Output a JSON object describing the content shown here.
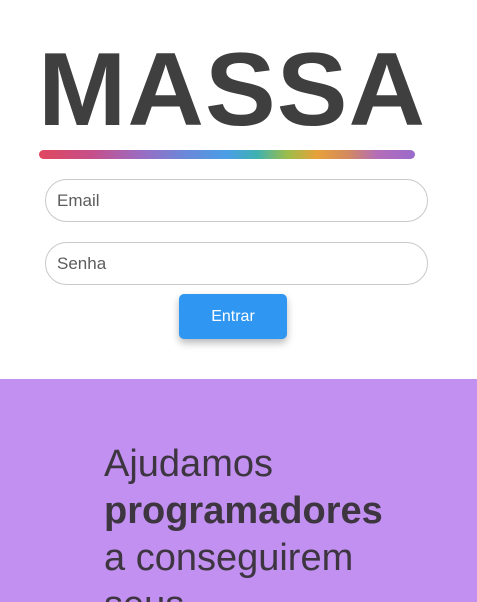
{
  "logo": {
    "text": "MASSA",
    "gradient_colors": [
      "#e0475e",
      "#c64f8a",
      "#9b6cc2",
      "#6e86d8",
      "#4a9ee6",
      "#3fb1b0",
      "#9cbd4a",
      "#e8a13a",
      "#d38a5e",
      "#b46db8",
      "#9a6ccc"
    ]
  },
  "login": {
    "email_placeholder": "Email",
    "password_placeholder": "Senha",
    "submit_label": "Entrar"
  },
  "hero": {
    "line1": "Ajudamos",
    "line2": "programadores",
    "line3": "a conseguirem",
    "line4": "seus"
  },
  "colors": {
    "button": "#2f96f1",
    "hero_background": "#c190f0",
    "logo_text": "#3f3f3f",
    "hero_text": "#3d3540"
  }
}
